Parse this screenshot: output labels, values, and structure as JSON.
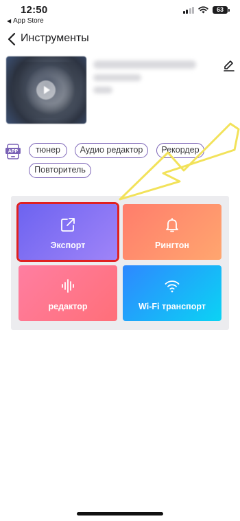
{
  "status_bar": {
    "time": "12:50",
    "back_app": "App Store",
    "battery": "63"
  },
  "nav": {
    "title": "Инструменты"
  },
  "tags": [
    "тюнер",
    "Аудио редактор",
    "Рекордер",
    "Повторитель"
  ],
  "tools": [
    {
      "label": "Экспорт",
      "icon": "export-icon",
      "highlighted": true
    },
    {
      "label": "Рингтон",
      "icon": "bell-icon"
    },
    {
      "label": "редактор",
      "icon": "waveform-icon"
    },
    {
      "label": "Wi-Fi транспорт",
      "icon": "wifi-icon"
    }
  ],
  "colors": {
    "accent_purple": "#7a62b6",
    "export_tile": "#8a74f5",
    "ringtone_tile": "#ff9270",
    "editor_tile": "#ff7590",
    "wifi_tile": "#19b0f8",
    "highlight_box": "#e02121",
    "annotation_arrow": "#f2e25a"
  }
}
